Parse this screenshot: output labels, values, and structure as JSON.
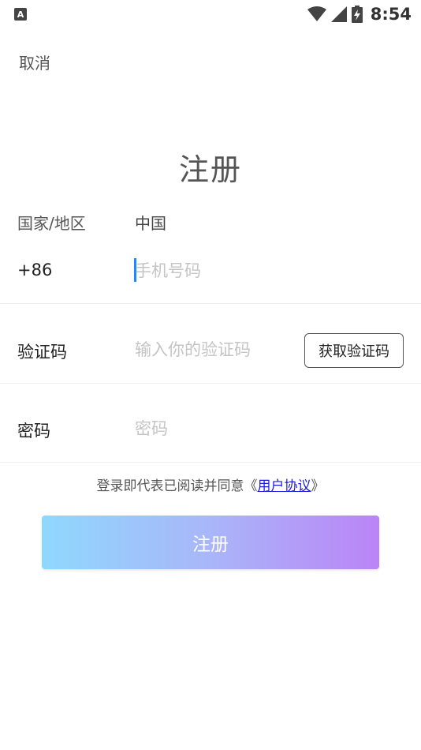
{
  "status_bar": {
    "app_icon_letter": "A",
    "time": "8:54",
    "icons": [
      "wifi-icon",
      "signal-icon",
      "battery-charging-icon"
    ]
  },
  "nav": {
    "cancel_label": "取消"
  },
  "page": {
    "title": "注册"
  },
  "form": {
    "region_label": "国家/地区",
    "region_value": "中国",
    "country_code": "+86",
    "phone_placeholder": "手机号码",
    "code_label": "验证码",
    "code_placeholder": "输入你的验证码",
    "get_code_label": "获取验证码",
    "password_label": "密码",
    "password_placeholder": "密码"
  },
  "agreement": {
    "prefix": "登录即代表已阅读并同意《",
    "link": "用户协议",
    "suffix": "》"
  },
  "submit": {
    "label": "注册"
  },
  "colors": {
    "caret": "#1a8cff",
    "gradient_start": "#8fd8fd",
    "gradient_end": "#bb84f6",
    "link": "#1a1adb"
  }
}
